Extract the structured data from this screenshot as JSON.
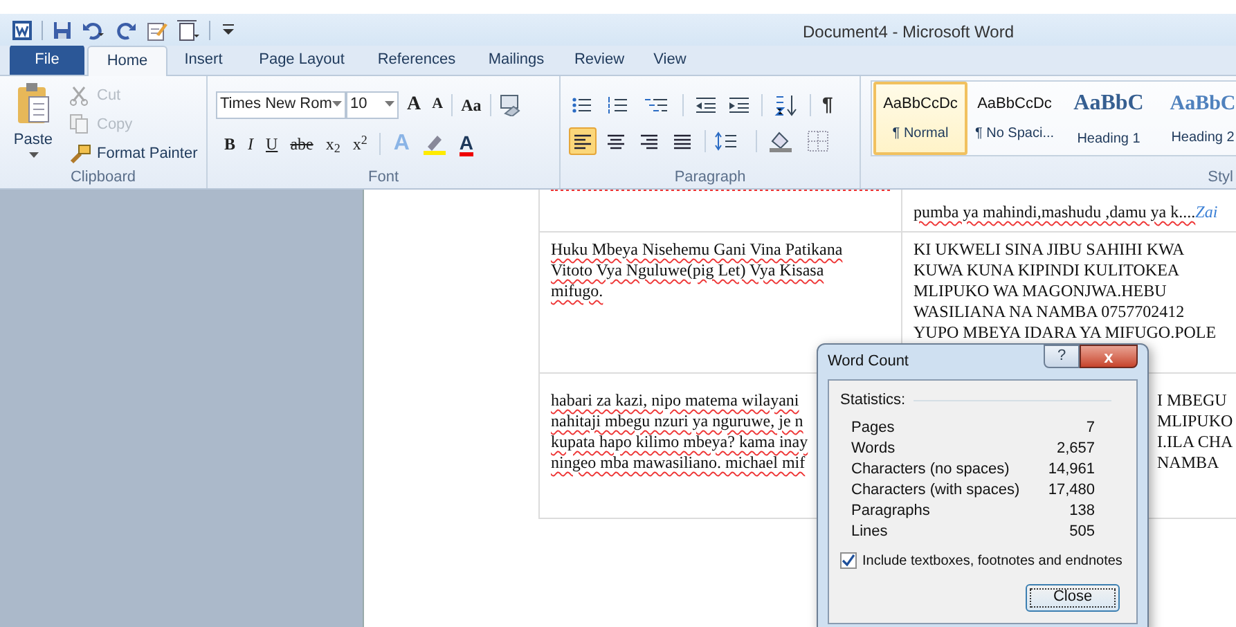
{
  "window": {
    "title": "Document4  -  Microsoft Word"
  },
  "tabs": [
    {
      "label": "File",
      "selected": false,
      "kind": "file"
    },
    {
      "label": "Home",
      "selected": true,
      "kind": "tab"
    },
    {
      "label": "Insert",
      "selected": false,
      "kind": "tab"
    },
    {
      "label": "Page Layout",
      "selected": false,
      "kind": "tab"
    },
    {
      "label": "References",
      "selected": false,
      "kind": "tab"
    },
    {
      "label": "Mailings",
      "selected": false,
      "kind": "tab"
    },
    {
      "label": "Review",
      "selected": false,
      "kind": "tab"
    },
    {
      "label": "View",
      "selected": false,
      "kind": "tab"
    }
  ],
  "clipboard": {
    "label": "Clipboard",
    "paste": "Paste",
    "items": [
      {
        "label": "Cut",
        "disabled": true
      },
      {
        "label": "Copy",
        "disabled": true
      },
      {
        "label": "Format Painter",
        "disabled": false
      }
    ]
  },
  "font": {
    "label": "Font",
    "font_name": "Times New Rom",
    "font_size": "10",
    "grow": "A",
    "shrink": "A",
    "case": "Aa",
    "format": [
      "B",
      "I",
      "U",
      "abe",
      "x$_{2}$",
      "x$^{2}$"
    ],
    "effects": "A",
    "color_button": "A"
  },
  "paragraph": {
    "label": "Paragraph",
    "pilcrow": "¶",
    "alignments": [
      {
        "selected": true
      },
      {
        "selected": false
      },
      {
        "selected": false
      },
      {
        "selected": false
      }
    ]
  },
  "styles": {
    "label": "Styl",
    "items": [
      {
        "preview": "AaBbCcDc",
        "name": "¶ Normal",
        "selected": true,
        "kind": "body"
      },
      {
        "preview": "AaBbCcDc",
        "name": "¶ No Spaci...",
        "selected": false,
        "kind": "body"
      },
      {
        "preview": "AaBbC",
        "name": "Heading 1",
        "selected": false,
        "kind": "heading1"
      },
      {
        "preview": "AaBbC",
        "name": "Heading 2",
        "selected": false,
        "kind": "heading2"
      }
    ]
  },
  "table": {
    "rows": [
      [
        {
          "misspelled": true
        },
        {
          "lines": [
            "pumba ya mahindi,mashudu ,damu ya k...."
          ],
          "link": "Zai",
          "misspelled": true
        }
      ],
      [
        {
          "lines": [
            "Huku Mbeya Nisehemu Gani Vina Patikana",
            "Vitoto Vya Nguluwe(pig  Let) Vya Kisasa",
            "mifugo."
          ],
          "misspelled": true
        },
        {
          "lines": [
            "KI UKWELI  SINA  JIBU SAHIHI KWA",
            "KUWA  KUNA  KIPINDI  KULITOKEA",
            "MLIPUKO  WA  MAGONJWA.HEBU",
            "WASILIANA  NA  NAMBA  0757702412",
            "YUPO  MBEYA  IDARA  YA  MIFUGO.POLE"
          ],
          "misspelled": false
        }
      ],
      [
        {
          "lines": [
            "habari za kazi, nipo matema wilayani",
            "nahitaji mbegu nzuri ya nguruwe, je n",
            "kupata hapo kilimo mbeya? kama inay",
            "ningeo  mba mawasiliano. michael mif"
          ],
          "misspelled": true
        },
        {
          "lines": [
            "I  MBEGU",
            "MLIPUKO",
            "I.ILA  CHA",
            "NAMBA"
          ],
          "misspelled": false,
          "covered": true
        }
      ]
    ]
  },
  "dialog": {
    "title": "Word Count",
    "help": "?",
    "close_glyph": "x",
    "section": "Statistics:",
    "stats": [
      {
        "label": "Pages",
        "value": "7"
      },
      {
        "label": "Words",
        "value": "2,657"
      },
      {
        "label": "Characters (no spaces)",
        "value": "14,961"
      },
      {
        "label": "Characters (with spaces)",
        "value": "17,480"
      },
      {
        "label": "Paragraphs",
        "value": "138"
      },
      {
        "label": "Lines",
        "value": "505"
      }
    ],
    "include": {
      "label": "Include textboxes, footnotes and endnotes",
      "checked": true
    },
    "close_button": "Close"
  }
}
